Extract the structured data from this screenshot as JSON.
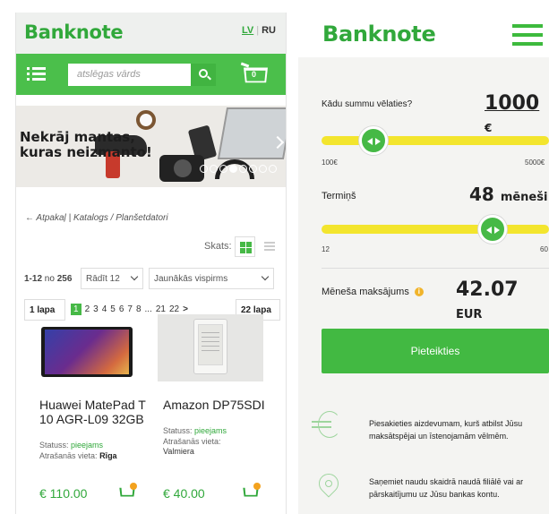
{
  "left": {
    "logo": "Banknote",
    "lang": {
      "lv": "LV",
      "separator": "|",
      "ru": "RU"
    },
    "search": {
      "placeholder": "atslēgas vārds"
    },
    "cart_count": "0",
    "banner": {
      "line1": "Nekrāj mantas,",
      "line2": "kuras neizmanto!"
    },
    "breadcrumb": {
      "back": "Atpakaļ",
      "sep1": "|",
      "catalog": "Katalogs",
      "sep2": "/",
      "current": "Planšetdatori"
    },
    "view_label": "Skats:",
    "results": {
      "range": "1-12",
      "of": "no",
      "total": "256"
    },
    "show_select": "Rādīt 12",
    "sort_select": "Jaunākās vispirms",
    "pager": {
      "first": "1 lapa",
      "pages": [
        "1",
        "2",
        "3",
        "4",
        "5",
        "6",
        "7",
        "8",
        "...",
        "21",
        "22"
      ],
      "next": ">",
      "last": "22 lapa"
    },
    "products": [
      {
        "name": "Huawei MatePad T 10 AGR-L09 32GB",
        "status_label": "Statuss:",
        "status": "pieejams",
        "location_label": "Atrašanās vieta:",
        "location": "Rīga",
        "price": "€ 110.00"
      },
      {
        "name": "Amazon DP75SDI",
        "status_label": "Statuss:",
        "status": "pieejams",
        "location_label": "Atrašanās vieta:",
        "location": "Valmiera",
        "price": "€ 40.00"
      }
    ]
  },
  "right": {
    "logo": "Banknote",
    "amount": {
      "label": "Kādu summu vēlaties?",
      "value": "1000",
      "unit": "€",
      "min": "100€",
      "max": "5000€",
      "fraction": 0.23
    },
    "term": {
      "label": "Termiņš",
      "value": "48",
      "unit": "mēneši",
      "min": "12",
      "max": "60",
      "fraction": 0.75
    },
    "monthly": {
      "label": "Mēneša maksājums",
      "info": "i",
      "value": "42.07",
      "unit": "EUR"
    },
    "apply_button": "Pieteikties",
    "features": [
      "Piesakieties aizdevumam, kurš atbilst Jūsu maksātspējai un īstenojamām vēlmēm.",
      "Saņemiet naudu skaidrā naudā filiālē vai ar pārskaitījumu uz Jūsu bankas kontu."
    ]
  },
  "colors": {
    "brand_green": "#31a83b",
    "bar_green": "#4bbf4b",
    "slider_yellow": "#f3e52e",
    "info_orange": "#f1b42b"
  }
}
